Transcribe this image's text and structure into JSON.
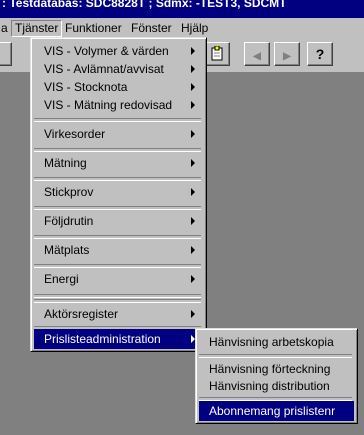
{
  "window": {
    "title": ": Testdatabas: SDC8828T ; Sdmx: -TEST3, SDCMT"
  },
  "menubar": {
    "items": [
      {
        "label": "a"
      },
      {
        "label": "Tjänster"
      },
      {
        "label": "Funktioner"
      },
      {
        "label": "Fönster"
      },
      {
        "label": "Hjälp"
      }
    ]
  },
  "toolbar": {
    "buttons": [
      {
        "icon": "document-icon"
      },
      {
        "icon": "prev-icon",
        "glyph": "◀"
      },
      {
        "icon": "next-icon",
        "glyph": "▶"
      },
      {
        "icon": "help-icon",
        "glyph": "?"
      }
    ]
  },
  "tjanster_menu": {
    "items": [
      "VIS - Volymer & värden",
      "VIS - Avlämnat/avvisat",
      "VIS - Stocknota",
      "VIS - Mätning redovisad",
      "Virkesorder",
      "Mätning",
      "Stickprov",
      "Följdrutin",
      "Mätplats",
      "Energi",
      "Aktörsregister",
      "Prislisteadministration"
    ]
  },
  "prislista_submenu": {
    "items": [
      "Hänvisning arbetskopia",
      "Hänvisning förteckning",
      "Hänvisning distribution",
      "Abonnemang prislistenr"
    ]
  }
}
